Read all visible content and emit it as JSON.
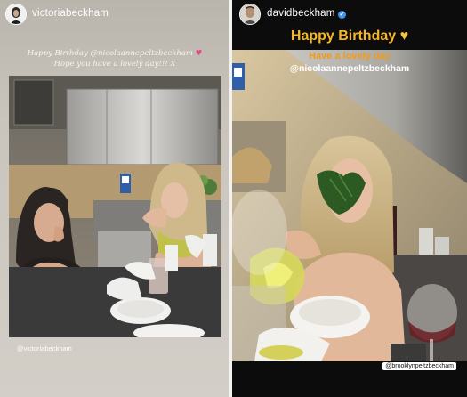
{
  "left_story": {
    "username": "victoriabeckham",
    "caption_line1_prefix": "Happy Birthday ",
    "caption_mention": "@nicolaannepeltzbeckham",
    "caption_line2": "Hope you have a lovely day!!! X",
    "heart_color": "#e04a8c",
    "tag": "@victoriabeckham"
  },
  "right_story": {
    "username": "davidbeckham",
    "verified": "✔",
    "title": "Happy Birthday",
    "title_heart": "♥",
    "subtitle": "Have a lovely day",
    "mention": "@nicolaannepeltzbeckham",
    "tag": "@brooklynpeltzbeckham"
  },
  "colors": {
    "title_gold": "#f5b72a",
    "subtitle_orange": "#f29a1c",
    "verified_blue": "#3d95ee"
  }
}
